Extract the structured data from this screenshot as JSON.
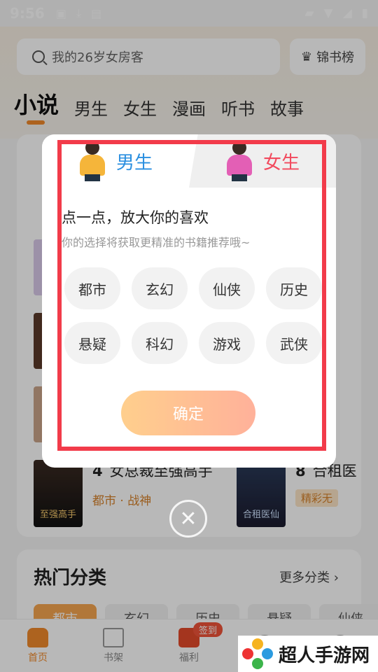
{
  "status_bar": {
    "time": "9:56"
  },
  "search": {
    "placeholder": "我的26岁女房客"
  },
  "rank_button": {
    "label": "锦书榜"
  },
  "tabs": [
    {
      "label": "小说"
    },
    {
      "label": "男生"
    },
    {
      "label": "女生"
    },
    {
      "label": "漫画"
    },
    {
      "label": "听书"
    },
    {
      "label": "故事"
    }
  ],
  "books": [
    {
      "rank": "4",
      "title": "女总裁至强高手",
      "sub": "都市 · 战神",
      "cover_text": "至强高手"
    },
    {
      "rank": "8",
      "title": "合租医",
      "tag": "精彩无",
      "cover_text": "合租医仙"
    }
  ],
  "categories": {
    "title": "热门分类",
    "more": "更多分类",
    "chips": [
      "都市",
      "玄幻",
      "历史",
      "悬疑",
      "仙侠"
    ]
  },
  "bottom_nav": [
    {
      "label": "首页"
    },
    {
      "label": "书架"
    },
    {
      "label": "福利",
      "badge": "签到"
    },
    {
      "label": ""
    },
    {
      "label": ""
    }
  ],
  "dialog": {
    "male_tab": "男生",
    "female_tab": "女生",
    "heading": "点一点，放大你的喜欢",
    "subtitle": "你的选择将获取更精准的书籍推荐哦~",
    "genres": [
      "都市",
      "玄幻",
      "仙侠",
      "历史",
      "悬疑",
      "科幻",
      "游戏",
      "武侠"
    ],
    "confirm": "确定"
  },
  "watermark": {
    "text": "超人手游网"
  },
  "colors": {
    "accent": "#f08a2c",
    "male": "#2a8fe0",
    "female": "#f2495d",
    "highlight": "#f23b4a"
  }
}
